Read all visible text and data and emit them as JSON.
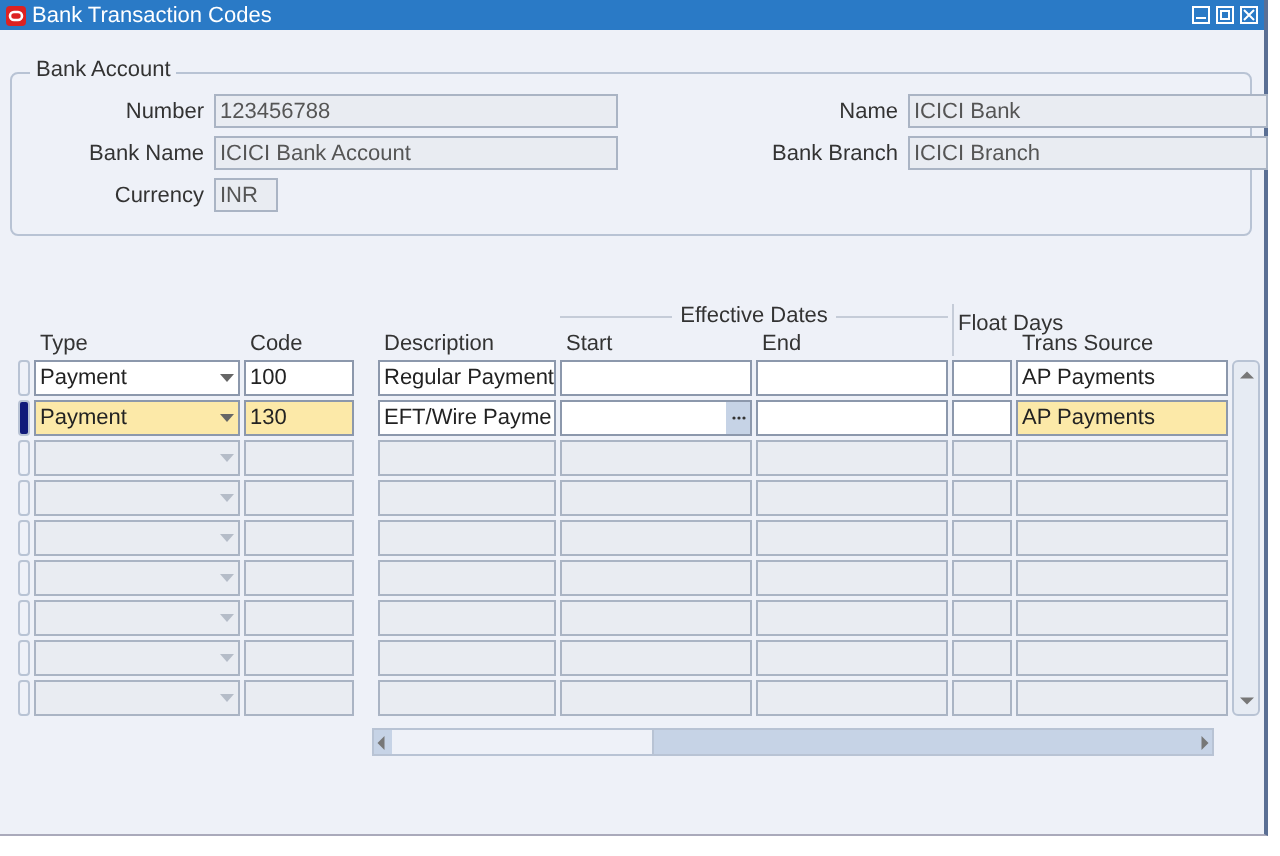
{
  "window": {
    "title": "Bank Transaction Codes"
  },
  "bank_account": {
    "title": "Bank Account",
    "left_fields": [
      {
        "label": "Number",
        "value": "123456788"
      },
      {
        "label": "Bank Name",
        "value": "ICICI Bank Account"
      }
    ],
    "right_fields": [
      {
        "label": "Name",
        "value": "ICICI Bank"
      },
      {
        "label": "Bank Branch",
        "value": "ICICI Branch"
      }
    ],
    "currency": {
      "label": "Currency",
      "value": "INR"
    }
  },
  "table": {
    "group_header": "Effective Dates",
    "float_header": "Float Days",
    "columns": [
      "Type",
      "Code",
      "Description",
      "Start",
      "End",
      "Trans Source"
    ],
    "rows": [
      {
        "type": "Payment",
        "code": "100",
        "description": "Regular Payment",
        "trans_source": "AP Payments",
        "current": false,
        "enabled": true
      },
      {
        "type": "Payment",
        "code": "130",
        "description": "EFT/Wire Payme",
        "trans_source": "AP Payments",
        "current": true,
        "enabled": true
      },
      {
        "current": false,
        "enabled": false
      },
      {
        "current": false,
        "enabled": false
      },
      {
        "current": false,
        "enabled": false
      },
      {
        "current": false,
        "enabled": false
      },
      {
        "current": false,
        "enabled": false
      },
      {
        "current": false,
        "enabled": false
      },
      {
        "current": false,
        "enabled": false
      }
    ]
  }
}
